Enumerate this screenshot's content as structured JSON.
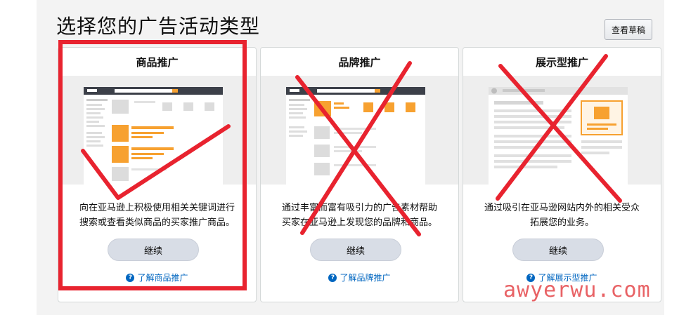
{
  "page": {
    "title": "选择您的广告活动类型",
    "draft_button": "查看草稿"
  },
  "cards": [
    {
      "title": "商品推广",
      "description_lines": [
        "向在亚马逊上积极使用相关关键词进行",
        "搜索或查看类似商品的买家推广商品。"
      ],
      "button": "继续",
      "link": "了解商品推广"
    },
    {
      "title": "品牌推广",
      "description_lines": [
        "通过丰富而富有吸引力的广告素材帮助",
        "买家在亚马逊上发现您的品牌和商品。"
      ],
      "button": "继续",
      "link": "了解品牌推广"
    },
    {
      "title": "展示型推广",
      "description_lines": [
        "通过吸引在亚马逊网站内外的相关受众",
        "拓展您的业务。"
      ],
      "button": "继续",
      "link": "了解展示型推广"
    }
  ],
  "watermark": "awyerwu.com",
  "colors": {
    "accent_orange": "#f7a130",
    "annotation_red": "#e8232f",
    "link_blue": "#0066c0",
    "header_dark": "#3c4049"
  }
}
